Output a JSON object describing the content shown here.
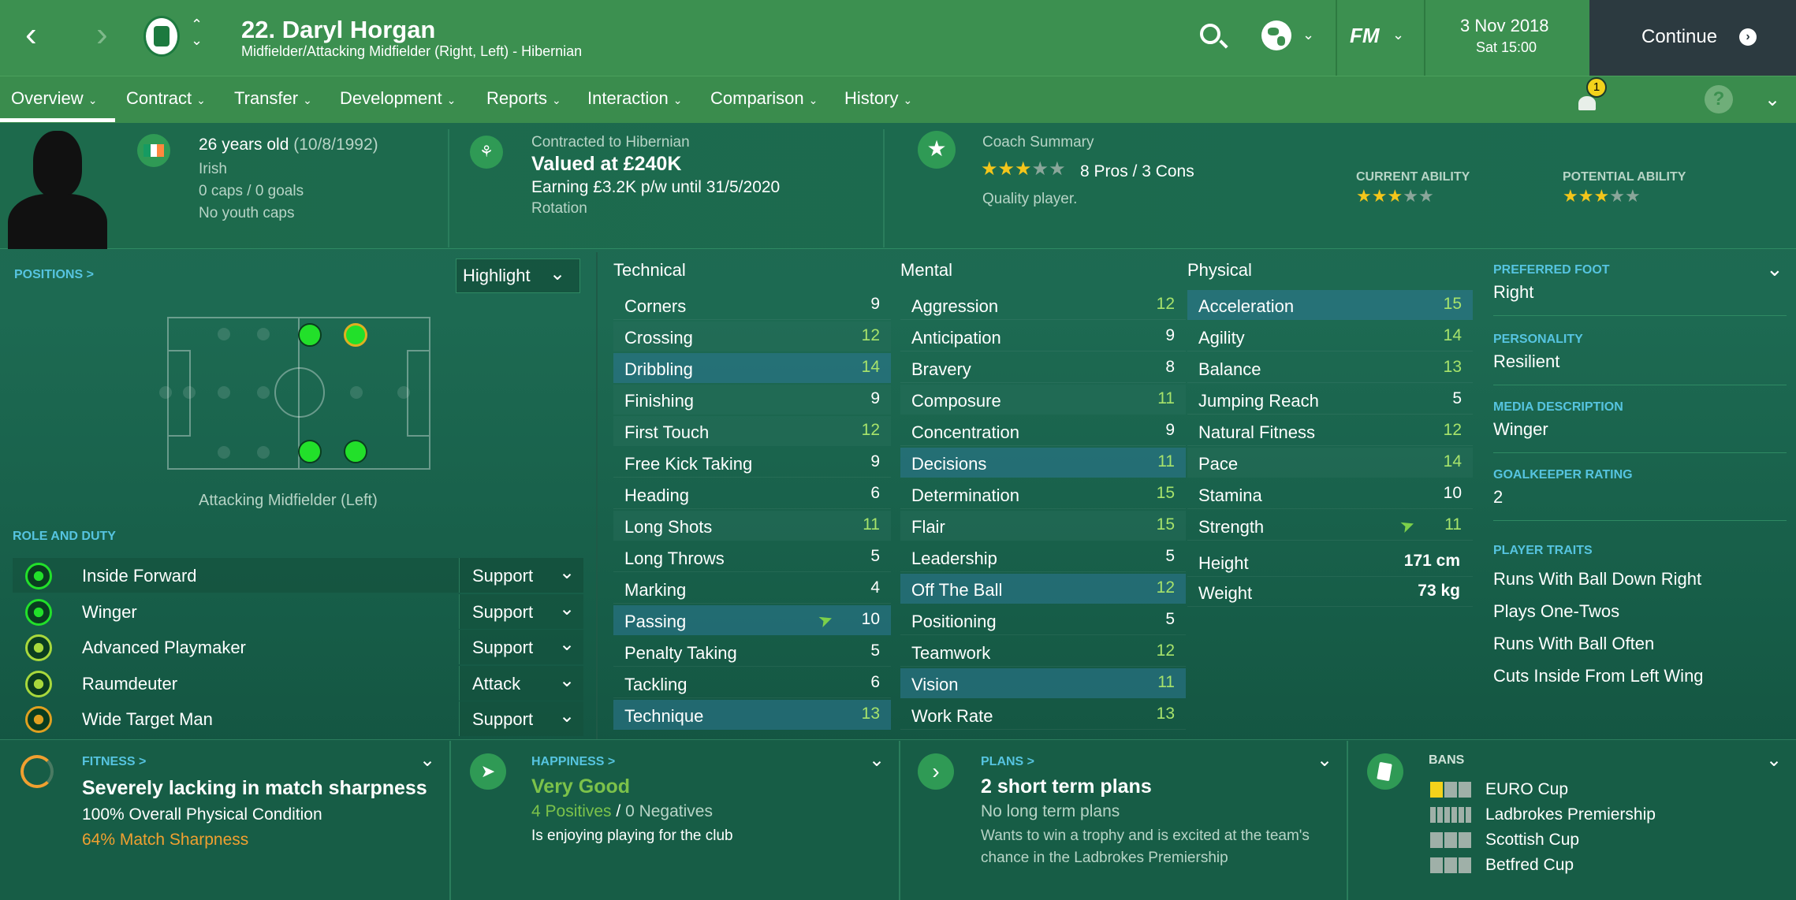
{
  "header": {
    "title": "22. Daryl Horgan",
    "subtitle": "Midfielder/Attacking Midfielder (Right, Left) - Hibernian",
    "date": "3 Nov 2018",
    "time": "Sat 15:00",
    "continue_label": "Continue",
    "fm_label": "FM"
  },
  "nav": {
    "tabs": [
      {
        "label": "Overview"
      },
      {
        "label": "Contract"
      },
      {
        "label": "Transfer"
      },
      {
        "label": "Development"
      },
      {
        "label": "Reports"
      },
      {
        "label": "Interaction"
      },
      {
        "label": "Comparison"
      },
      {
        "label": "History"
      }
    ],
    "notification_count": "1",
    "help": "?"
  },
  "info": {
    "age": "26 years old",
    "dob": "(10/8/1992)",
    "nationality": "Irish",
    "caps": "0 caps / 0 goals",
    "youth": "No youth caps",
    "contract_label": "Contracted to Hibernian",
    "value": "Valued at £240K",
    "earning": "Earning £3.2K p/w until 31/5/2020",
    "status": "Rotation",
    "coach_label": "Coach Summary",
    "pros_cons": "8 Pros / 3 Cons",
    "coach_note": "Quality player.",
    "current_ability_label": "CURRENT ABILITY",
    "potential_ability_label": "POTENTIAL ABILITY",
    "coach_stars": 3,
    "current_stars": 3,
    "potential_stars": 3
  },
  "positions": {
    "label": "POSITIONS >",
    "highlight": "Highlight",
    "position_name": "Attacking Midfielder (Left)",
    "role_label": "ROLE AND DUTY",
    "roles": [
      {
        "name": "Inside Forward",
        "duty": "Support"
      },
      {
        "name": "Winger",
        "duty": "Support"
      },
      {
        "name": "Advanced Playmaker",
        "duty": "Support"
      },
      {
        "name": "Raumdeuter",
        "duty": "Attack"
      },
      {
        "name": "Wide Target Man",
        "duty": "Support"
      }
    ]
  },
  "attributes": {
    "technical_label": "Technical",
    "mental_label": "Mental",
    "physical_label": "Physical",
    "technical": [
      {
        "name": "Corners",
        "value": "9"
      },
      {
        "name": "Crossing",
        "value": "12"
      },
      {
        "name": "Dribbling",
        "value": "14"
      },
      {
        "name": "Finishing",
        "value": "9"
      },
      {
        "name": "First Touch",
        "value": "12"
      },
      {
        "name": "Free Kick Taking",
        "value": "9"
      },
      {
        "name": "Heading",
        "value": "6"
      },
      {
        "name": "Long Shots",
        "value": "11"
      },
      {
        "name": "Long Throws",
        "value": "5"
      },
      {
        "name": "Marking",
        "value": "4"
      },
      {
        "name": "Passing",
        "value": "10"
      },
      {
        "name": "Penalty Taking",
        "value": "5"
      },
      {
        "name": "Tackling",
        "value": "6"
      },
      {
        "name": "Technique",
        "value": "13"
      }
    ],
    "mental": [
      {
        "name": "Aggression",
        "value": "12"
      },
      {
        "name": "Anticipation",
        "value": "9"
      },
      {
        "name": "Bravery",
        "value": "8"
      },
      {
        "name": "Composure",
        "value": "11"
      },
      {
        "name": "Concentration",
        "value": "9"
      },
      {
        "name": "Decisions",
        "value": "11"
      },
      {
        "name": "Determination",
        "value": "15"
      },
      {
        "name": "Flair",
        "value": "15"
      },
      {
        "name": "Leadership",
        "value": "5"
      },
      {
        "name": "Off The Ball",
        "value": "12"
      },
      {
        "name": "Positioning",
        "value": "5"
      },
      {
        "name": "Teamwork",
        "value": "12"
      },
      {
        "name": "Vision",
        "value": "11"
      },
      {
        "name": "Work Rate",
        "value": "13"
      }
    ],
    "physical": [
      {
        "name": "Acceleration",
        "value": "15"
      },
      {
        "name": "Agility",
        "value": "14"
      },
      {
        "name": "Balance",
        "value": "13"
      },
      {
        "name": "Jumping Reach",
        "value": "5"
      },
      {
        "name": "Natural Fitness",
        "value": "12"
      },
      {
        "name": "Pace",
        "value": "14"
      },
      {
        "name": "Stamina",
        "value": "10"
      },
      {
        "name": "Strength",
        "value": "11"
      },
      {
        "name": "Height",
        "value": "171 cm"
      },
      {
        "name": "Weight",
        "value": "73 kg"
      }
    ]
  },
  "side": {
    "foot_label": "PREFERRED FOOT",
    "foot": "Right",
    "personality_label": "PERSONALITY",
    "personality": "Resilient",
    "media_label": "MEDIA DESCRIPTION",
    "media": "Winger",
    "gk_label": "GOALKEEPER RATING",
    "gk": "2",
    "traits_label": "PLAYER TRAITS",
    "traits": [
      "Runs With Ball Down Right",
      "Plays One-Twos",
      "Runs With Ball Often",
      "Cuts Inside From Left Wing"
    ]
  },
  "bottom": {
    "fitness_label": "FITNESS >",
    "fitness_title": "Severely lacking in match sharpness",
    "fitness_line1": "100% Overall Physical Condition",
    "fitness_line2": "64% Match Sharpness",
    "happiness_label": "HAPPINESS >",
    "happiness_title": "Very Good",
    "positives": "4 Positives",
    "slash": "/",
    "negatives": "0 Negatives",
    "happiness_note": "Is enjoying playing for the club",
    "plans_label": "PLANS >",
    "plans_title": "2 short term plans",
    "plans_sub": "No long term plans",
    "plans_note1": "Wants to win a trophy and is excited at the team's",
    "plans_note2": "chance in the Ladbrokes Premiership",
    "bans_label": "BANS",
    "bans": [
      "EURO Cup",
      "Ladbrokes Premiership",
      "Scottish Cup",
      "Betfred Cup"
    ]
  },
  "colors": {
    "accent": "#3c9050",
    "highlight_value": "#a7e36b",
    "link": "#56c4e0",
    "star": "#f3c61b",
    "sharpness": "#f0a030"
  }
}
